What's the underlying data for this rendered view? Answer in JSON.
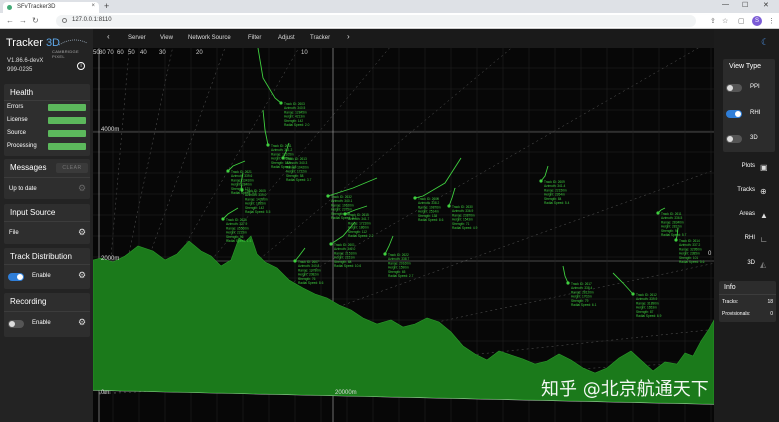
{
  "browser": {
    "tab_title": "SFvTracker3D",
    "tab_close": "×",
    "new_tab": "+",
    "url": "127.0.0.1:8110",
    "win_min": "—",
    "win_max": "☐",
    "win_close": "✕",
    "profile_initial": "S"
  },
  "app": {
    "logo_prefix": "Tracker ",
    "logo_suffix": "3D",
    "logo_sub": "CAMBRIDGE PIXEL",
    "version": "V1.86.6-devX",
    "serial": "999-0235",
    "info_icon": "i"
  },
  "health": {
    "title": "Health",
    "rows": [
      {
        "label": "Errors",
        "color": "#5cb85c"
      },
      {
        "label": "License",
        "color": "#5cb85c"
      },
      {
        "label": "Source",
        "color": "#5cb85c"
      },
      {
        "label": "Processing",
        "color": "#5cb85c"
      }
    ]
  },
  "messages": {
    "title": "Messages",
    "clear_label": "CLEAR",
    "status": "Up to date"
  },
  "input_source": {
    "title": "Input Source",
    "item": "File"
  },
  "track_distribution": {
    "title": "Track Distribution",
    "toggle_label": "Enable",
    "enabled": true
  },
  "recording": {
    "title": "Recording",
    "toggle_label": "Enable",
    "enabled": false
  },
  "menu": {
    "back": "‹",
    "forward": "›",
    "items": [
      "Server",
      "View",
      "Network Source",
      "Filter",
      "Adjust",
      "Tracker"
    ]
  },
  "right_panel": {
    "theme_icon": "moon-icon",
    "view_type": {
      "title": "View Type",
      "options": [
        {
          "label": "PPI",
          "on": false
        },
        {
          "label": "RHI",
          "on": true
        },
        {
          "label": "3D",
          "on": false
        }
      ]
    },
    "buttons": [
      {
        "label": "Plots",
        "icon": "▣"
      },
      {
        "label": "Tracks",
        "icon": "⊕"
      },
      {
        "label": "Areas",
        "icon": "▲"
      },
      {
        "label": "RHI",
        "icon": "∟"
      },
      {
        "label": "3D",
        "icon": "◭"
      }
    ],
    "info": {
      "title": "Info",
      "rows": [
        {
          "label": "Tracks:",
          "value": "18"
        },
        {
          "label": "Provisionals:",
          "value": "0"
        }
      ]
    }
  },
  "viz": {
    "angle_labels": [
      "50",
      "80",
      "70",
      "60",
      "50",
      "40",
      "30",
      "20",
      "10"
    ],
    "altitude_labels": [
      "4000m",
      "2000m"
    ],
    "range_labels": [
      "0m",
      "20000m"
    ],
    "side_label": "0",
    "terrain_color": "#1b7a1b",
    "track_color": "#3fcf3f",
    "tracks": [
      {
        "lines": [
          "Track ID: 2603",
          "Azimuth: 340.5",
          "Range: 12845m",
          "Height: 4213m",
          "Strength: 142",
          "Radial Speed: 2.0"
        ]
      },
      {
        "lines": [
          "Track ID: 2611",
          "Azimuth: 341.2",
          "Range: 12105m",
          "Height: 2958m",
          "Strength: 142",
          "Radial Speed: 3.8"
        ]
      },
      {
        "lines": [
          "Track ID: 2621",
          "Azimuth: 339.6",
          "Range: 13410m",
          "Height: 2840m",
          "Strength: 121",
          "Radial Speed: 3.3"
        ]
      },
      {
        "lines": [
          "Track ID: 2608",
          "Azimuth: 338.2",
          "Range: 19876m",
          "Height: 2514m",
          "Strength: 138",
          "Radial Speed: 8.6"
        ]
      },
      {
        "lines": [
          "Track ID: 2632",
          "Azimuth: 340.1",
          "Range: 19620m",
          "Height: 2375m",
          "Strength: 118",
          "Radial Speed: 3.3"
        ]
      },
      {
        "lines": [
          "Track ID: 2609",
          "Azimuth: 341.4",
          "Range: 22150m",
          "Height: 2264m",
          "Strength: 84",
          "Radial Speed: 5.4"
        ]
      },
      {
        "lines": [
          "Track ID: 2626",
          "Azimuth: 337.9",
          "Range: 15560m",
          "Height: 2215m",
          "Strength: 96",
          "Radial Speed: 1.6"
        ]
      },
      {
        "lines": [
          "Track ID: 2601",
          "Azimuth: 342.0",
          "Range: 21510m",
          "Height: 2151m",
          "Strength: 88",
          "Radial Speed: 10.6"
        ]
      },
      {
        "lines": [
          "Track ID: 2607",
          "Azimuth: 340.8",
          "Range: 12780m",
          "Height: 2082m",
          "Strength: 76",
          "Radial Speed: 8.6"
        ]
      },
      {
        "lines": [
          "Track ID: 2605",
          "Azimuth: 339.0",
          "Range: 14390m",
          "Height: 1895m",
          "Strength: 142",
          "Radial Speed: 5.5"
        ]
      },
      {
        "lines": [
          "Track ID: 2615",
          "Azimuth: 341.7",
          "Range: 17210m",
          "Height: 1860m",
          "Strength: 112",
          "Radial Speed: 2.2"
        ]
      },
      {
        "lines": [
          "Track ID: 2611",
          "Azimuth: 336.5",
          "Range: 28340m",
          "Height: 2812m",
          "Strength: 94",
          "Radial Speed: 5.7"
        ]
      },
      {
        "lines": [
          "Track ID: 2614",
          "Azimuth: 337.2",
          "Range: 32950m",
          "Height: 2385m",
          "Strength: 101",
          "Radial Speed: 5.6"
        ]
      },
      {
        "lines": [
          "Track ID: 2617",
          "Azimuth: 338.4",
          "Range: 28120m",
          "Height: 1702m",
          "Strength: 79",
          "Radial Speed: 6.1"
        ]
      },
      {
        "lines": [
          "Track ID: 2612",
          "Azimuth: 339.9",
          "Range: 31890m",
          "Height: 1653m",
          "Strength: 87",
          "Radial Speed: 6.9"
        ]
      },
      {
        "lines": [
          "Track ID: 2622",
          "Azimuth: 338.7",
          "Range: 20160m",
          "Height: 1590m",
          "Strength: 65",
          "Radial Speed: 2.7"
        ]
      },
      {
        "lines": [
          "Track ID: 2613",
          "Azimuth: 340.3",
          "Range: 10420m",
          "Height: 1722m",
          "Strength: 58",
          "Radial Speed: 3.7"
        ]
      },
      {
        "lines": [
          "Track ID: 2630",
          "Azimuth: 336.9",
          "Range: 23870m",
          "Height: 1543m",
          "Strength: 71",
          "Radial Speed: 4.9"
        ]
      }
    ]
  },
  "watermark": "知乎 @北京航通天下"
}
